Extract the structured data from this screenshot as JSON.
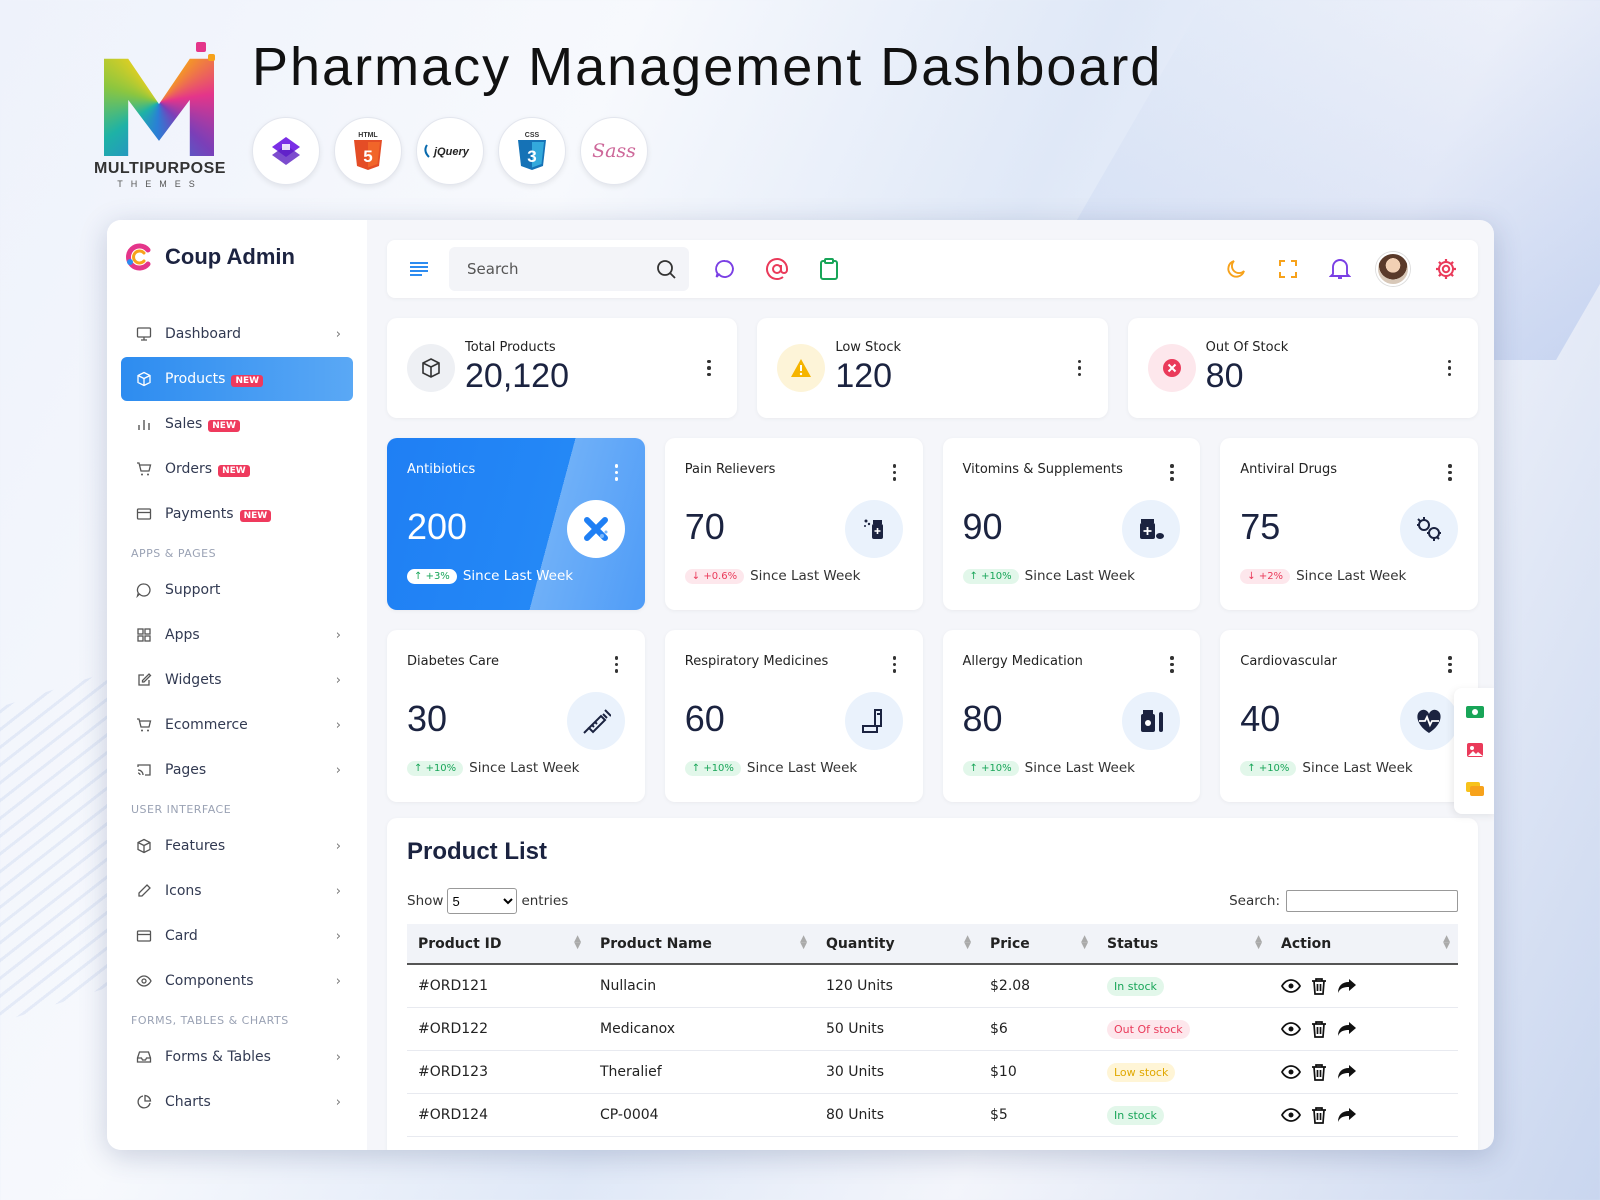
{
  "hero": {
    "title": "Pharmacy Management Dashboard",
    "logo_word": "MULTIPURPOSE",
    "logo_sub": "THEMES",
    "tech_icons": [
      "bootstrap-icon",
      "html5-icon",
      "jquery-icon",
      "css3-icon",
      "sass-icon"
    ],
    "jquery_label": "jQuery",
    "sass_label": "Sass",
    "html_label": "HTML",
    "css_label": "CSS"
  },
  "sidebar": {
    "brand": "Coup Admin",
    "items": [
      {
        "label": "Dashboard",
        "icon": "monitor-icon",
        "chevron": true
      },
      {
        "label": "Products",
        "icon": "box-icon",
        "badge": "NEW",
        "active": true
      },
      {
        "label": "Sales",
        "icon": "bar-chart-icon",
        "badge": "NEW"
      },
      {
        "label": "Orders",
        "icon": "cart-icon",
        "badge": "NEW"
      },
      {
        "label": "Payments",
        "icon": "credit-card-icon",
        "badge": "NEW"
      }
    ],
    "section_apps": "APPS & PAGES",
    "apps_items": [
      {
        "label": "Support",
        "icon": "chat-icon"
      },
      {
        "label": "Apps",
        "icon": "grid-icon",
        "chevron": true
      },
      {
        "label": "Widgets",
        "icon": "edit-icon",
        "chevron": true
      },
      {
        "label": "Ecommerce",
        "icon": "cart-icon",
        "chevron": true
      },
      {
        "label": "Pages",
        "icon": "cast-icon",
        "chevron": true
      }
    ],
    "section_ui": "USER INTERFACE",
    "ui_items": [
      {
        "label": "Features",
        "icon": "box-icon",
        "chevron": true
      },
      {
        "label": "Icons",
        "icon": "pen-icon",
        "chevron": true
      },
      {
        "label": "Card",
        "icon": "card-icon",
        "chevron": true
      },
      {
        "label": "Components",
        "icon": "eye-icon",
        "chevron": true
      }
    ],
    "section_forms": "FORMS, TABLES & CHARTS",
    "forms_items": [
      {
        "label": "Forms & Tables",
        "icon": "inbox-icon",
        "chevron": true
      },
      {
        "label": "Charts",
        "icon": "pie-chart-icon",
        "chevron": true
      }
    ]
  },
  "topbar": {
    "search_placeholder": "Search",
    "colors": {
      "menu": "#2d8cf0",
      "chat": "#7a3fe4",
      "at": "#ea3a5a",
      "clip": "#18a558",
      "moon": "#f7a21b",
      "expand": "#f7a21b",
      "bell": "#7a3fe4",
      "gear": "#ea3a5a"
    }
  },
  "stats": [
    {
      "title": "Total Products",
      "value": "20,120",
      "icon": "cube-icon",
      "bg": "#eef0f4",
      "color": "#333"
    },
    {
      "title": "Low Stock",
      "value": "120",
      "icon": "warning-icon",
      "bg": "#fdf4d8",
      "color": "#f5b400"
    },
    {
      "title": "Out Of Stock",
      "value": "80",
      "icon": "x-circle-icon",
      "bg": "#fde7ec",
      "color": "#ea3a5a"
    }
  ],
  "categories": [
    {
      "name": "Antibiotics",
      "value": "200",
      "change": "+3%",
      "dir": "up",
      "since": "Since Last Week",
      "icon": "pill-icon",
      "primary": true
    },
    {
      "name": "Pain Relievers",
      "value": "70",
      "change": "+0.6%",
      "dir": "down",
      "since": "Since Last Week",
      "icon": "medicine-bottle-icon"
    },
    {
      "name": "Vitomins & Supplements",
      "value": "90",
      "change": "+10%",
      "dir": "up",
      "since": "Since Last Week",
      "icon": "supplements-icon"
    },
    {
      "name": "Antiviral Drugs",
      "value": "75",
      "change": "+2%",
      "dir": "down",
      "since": "Since Last Week",
      "icon": "virus-icon"
    },
    {
      "name": "Diabetes Care",
      "value": "30",
      "change": "+10%",
      "dir": "up",
      "since": "Since Last Week",
      "icon": "syringe-icon"
    },
    {
      "name": "Respiratory Medicines",
      "value": "60",
      "change": "+10%",
      "dir": "up",
      "since": "Since Last Week",
      "icon": "inhaler-icon"
    },
    {
      "name": "Allergy Medication",
      "value": "80",
      "change": "+10%",
      "dir": "up",
      "since": "Since Last Week",
      "icon": "medication-jar-icon"
    },
    {
      "name": "Cardiovascular",
      "value": "40",
      "change": "+10%",
      "dir": "up",
      "since": "Since Last Week",
      "icon": "heart-pulse-icon"
    }
  ],
  "product_list": {
    "title": "Product List",
    "show": "Show",
    "entries": "entries",
    "page_size": "5",
    "search_label": "Search:",
    "columns": [
      "Product ID",
      "Product Name",
      "Quantity",
      "Price",
      "Status",
      "Action"
    ],
    "rows": [
      {
        "id": "#ORD121",
        "name": "Nullacin",
        "qty": "120 Units",
        "price": "$2.08",
        "status": "In stock",
        "kind": "in"
      },
      {
        "id": "#ORD122",
        "name": "Medicanox",
        "qty": "50 Units",
        "price": "$6",
        "status": "Out Of stock",
        "kind": "out"
      },
      {
        "id": "#ORD123",
        "name": "Theralief",
        "qty": "30 Units",
        "price": "$10",
        "status": "Low stock",
        "kind": "low"
      },
      {
        "id": "#ORD124",
        "name": "CP-0004",
        "qty": "80 Units",
        "price": "$5",
        "status": "In stock",
        "kind": "in"
      }
    ]
  }
}
